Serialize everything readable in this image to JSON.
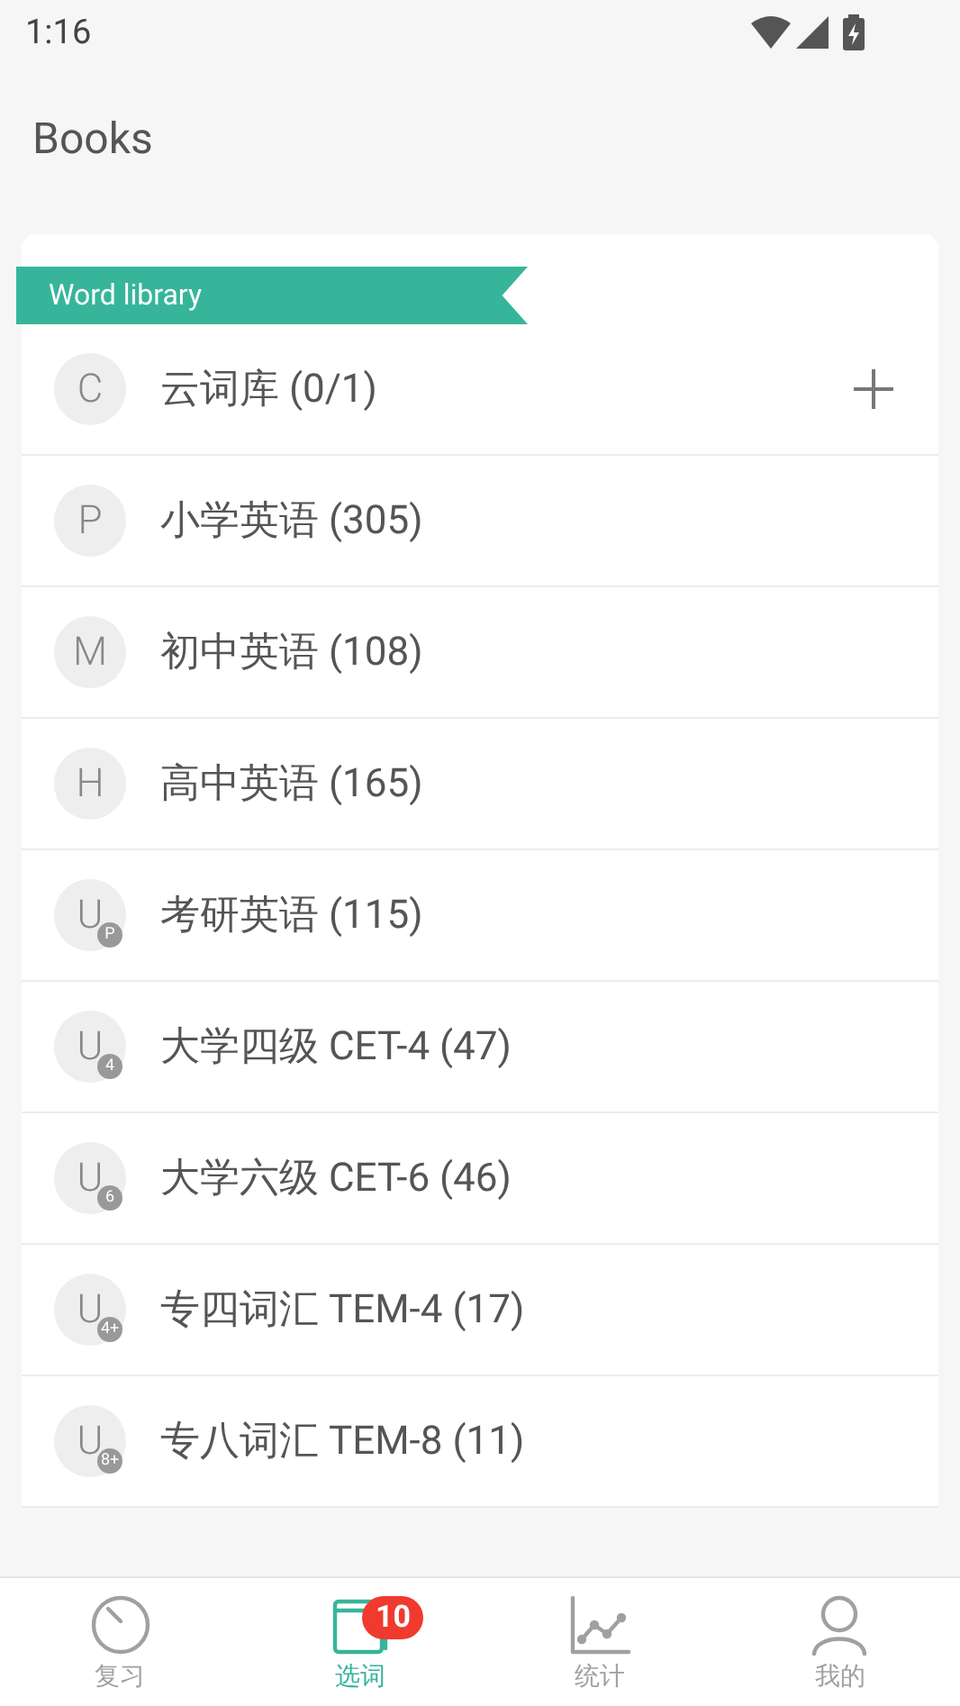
{
  "status_bar": {
    "time": "1:16"
  },
  "header": {
    "title": "Books"
  },
  "section": {
    "ribbon": "Word library"
  },
  "books": [
    {
      "letter": "C",
      "title": "云词库 (0/1)",
      "add_button": true
    },
    {
      "letter": "P",
      "title": "小学英语 (305)",
      "add_button": false
    },
    {
      "letter": "M",
      "title": "初中英语 (108)",
      "add_button": false
    },
    {
      "letter": "H",
      "title": "高中英语 (165)",
      "add_button": false
    },
    {
      "letter": "U",
      "badge": "P",
      "title": "考研英语 (115)",
      "add_button": false
    },
    {
      "letter": "U",
      "badge": "4",
      "title": "大学四级 CET-4 (47)",
      "add_button": false
    },
    {
      "letter": "U",
      "badge": "6",
      "title": "大学六级 CET-6 (46)",
      "add_button": false
    },
    {
      "letter": "U",
      "badge": "4+",
      "title": "专四词汇 TEM-4 (17)",
      "add_button": false
    },
    {
      "letter": "U",
      "badge": "8+",
      "title": "专八词汇 TEM-8 (11)",
      "add_button": false
    }
  ],
  "tabs": [
    {
      "kind": "review",
      "label": "复习",
      "selected": false
    },
    {
      "kind": "words",
      "label": "选词",
      "selected": true,
      "badge": "10"
    },
    {
      "kind": "stats",
      "label": "统计",
      "selected": false
    },
    {
      "kind": "profile",
      "label": "我的",
      "selected": false
    }
  ]
}
